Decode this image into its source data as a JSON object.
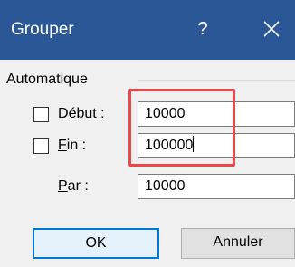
{
  "dialog": {
    "title": "Grouper",
    "help_label": "?"
  },
  "group": {
    "label": "Automatique"
  },
  "fields": {
    "debut": {
      "label_mnemonic": "D",
      "label_rest": "ébut :",
      "checked": false,
      "value": "10000"
    },
    "fin": {
      "label_mnemonic": "F",
      "label_rest": "in :",
      "checked": false,
      "value": "100000"
    },
    "par": {
      "label_mnemonic": "P",
      "label_rest": "ar :",
      "value": "10000"
    }
  },
  "buttons": {
    "ok_label": "OK",
    "cancel_label": "Annuler"
  },
  "colors": {
    "titlebar": "#2b5797",
    "highlight": "#e8494a",
    "default_button_border": "#0078d7"
  }
}
